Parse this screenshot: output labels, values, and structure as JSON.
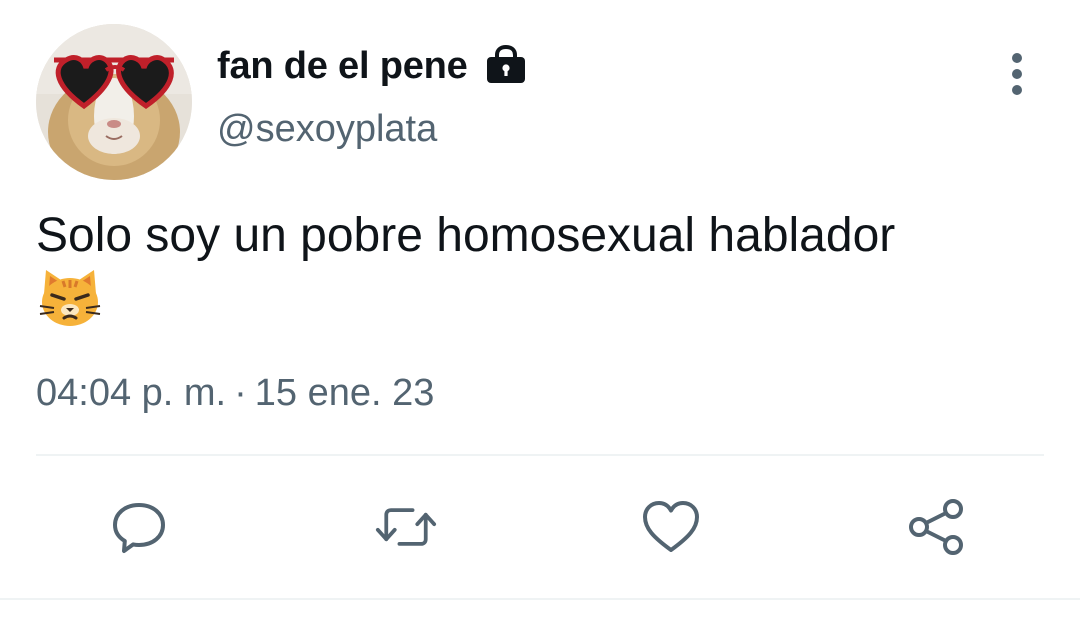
{
  "tweet": {
    "display_name": "fan de el pene",
    "handle": "@sexoyplata",
    "protected": true,
    "text": "Solo soy un pobre homosexual hablador",
    "emoji": "😾",
    "time": "04:04 p. m.",
    "separator": "·",
    "date": "15 ene. 23"
  },
  "icons": {
    "lock": "lock-icon",
    "more": "more-vertical-icon",
    "reply": "reply-icon",
    "retweet": "retweet-icon",
    "like": "heart-icon",
    "share": "share-icon"
  },
  "colors": {
    "text_primary": "#0f1419",
    "text_secondary": "#536471",
    "icon": "#536471",
    "divider": "#eff3f4"
  }
}
